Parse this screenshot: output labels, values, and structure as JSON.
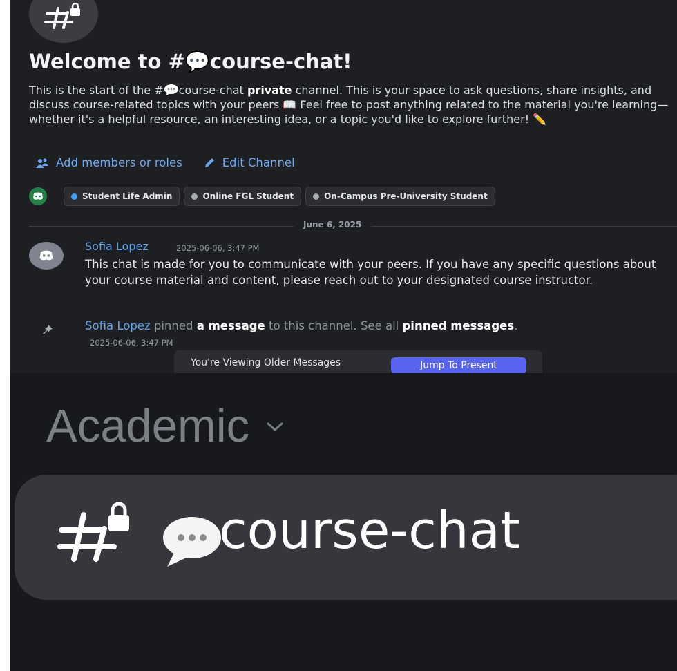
{
  "header": {
    "welcome": "Welcome to #💬course-chat!",
    "description": {
      "p1": "This is the start of the #",
      "p2": "course-chat ",
      "bold": "private",
      "p3": " channel. This is your space to ask questions, share insights, and discuss course-related topics with your peers ",
      "p4": " Feel free to post anything related to the material you're learning—whether it's a helpful resource, an interesting idea, or a topic you'd like to explore further! ",
      "book_emoji": "📖",
      "pencil_emoji": "✏️"
    }
  },
  "actions": {
    "add_members": "Add members or roles",
    "edit_channel": "Edit Channel"
  },
  "roles": [
    {
      "label": "Student Life Admin",
      "color": "#3b9ff5"
    },
    {
      "label": "Online FGL Student",
      "color": "#a8abb2"
    },
    {
      "label": "On-Campus Pre-University Student",
      "color": "#a8abb2"
    }
  ],
  "date_divider": "June 6, 2025",
  "message": {
    "author": "Sofia Lopez",
    "timestamp": "2025-06-06, 3:47 PM",
    "text": "This chat is made for you to communicate with your peers. If you have any specific questions about your course material and content, please reach out to your designated course instructor."
  },
  "system_pin": {
    "who": "Sofia Lopez",
    "t1": " pinned ",
    "link1": "a message",
    "t2": " to this channel. See all ",
    "link2": "pinned messages",
    "t3": ".",
    "timestamp": "2025-06-06, 3:47 PM"
  },
  "older_bar": {
    "text": "You're Viewing Older Messages",
    "button": "Jump To Present"
  },
  "sidebar": {
    "category": "Academic",
    "channel": "course-chat"
  },
  "colors": {
    "accent": "#5865f2",
    "link": "#60a5e8",
    "online_green": "#248046"
  },
  "icons": [
    "private-hash-icon",
    "add-members-icon",
    "edit-pencil-icon",
    "discord-logo-icon",
    "pin-icon",
    "chevron-down-icon",
    "speech-bubble-icon"
  ]
}
